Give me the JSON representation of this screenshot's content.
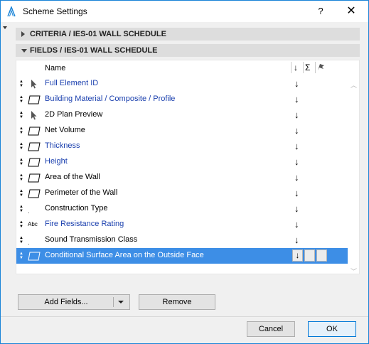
{
  "window": {
    "title": "Scheme Settings",
    "help_label": "?",
    "close_label": "✕"
  },
  "panels": {
    "criteria": {
      "label": "CRITERIA / IES-01 WALL SCHEDULE",
      "expanded": false
    },
    "fields": {
      "label": "FIELDS / IES-01 WALL SCHEDULE",
      "expanded": true
    }
  },
  "list": {
    "header": {
      "name": "Name",
      "sort": "↓",
      "sum": "Σ",
      "flag": "flag-icon"
    },
    "rows": [
      {
        "label": "Full Element ID",
        "icon": "pointer-icon",
        "blue": true,
        "sort": "↓"
      },
      {
        "label": "Building Material / Composite / Profile",
        "icon": "parallelogram-icon",
        "blue": true,
        "sort": "↓"
      },
      {
        "label": "2D Plan Preview",
        "icon": "pointer-icon",
        "blue": false,
        "sort": "↓"
      },
      {
        "label": "Net Volume",
        "icon": "parallelogram-icon",
        "blue": false,
        "sort": "↓"
      },
      {
        "label": "Thickness",
        "icon": "parallelogram-icon",
        "blue": true,
        "sort": "↓"
      },
      {
        "label": "Height",
        "icon": "parallelogram-icon",
        "blue": true,
        "sort": "↓"
      },
      {
        "label": "Area of the Wall",
        "icon": "parallelogram-icon",
        "blue": false,
        "sort": "↓"
      },
      {
        "label": "Perimeter of the Wall",
        "icon": "parallelogram-icon",
        "blue": false,
        "sort": "↓"
      },
      {
        "label": "Construction Type",
        "icon": "dot-icon",
        "blue": false,
        "sort": "↓"
      },
      {
        "label": "Fire Resistance Rating",
        "icon": "abc-icon",
        "icon_text": "Abc",
        "blue": true,
        "sort": "↓"
      },
      {
        "label": "Sound Transmission Class",
        "icon": "dot-icon",
        "blue": false,
        "sort": "↓"
      },
      {
        "label": "Conditional Surface Area on the Outside Face",
        "icon": "parallelogram-icon",
        "blue": false,
        "sort": "↓",
        "selected": true
      }
    ]
  },
  "buttons": {
    "add_fields": "Add Fields...",
    "remove": "Remove",
    "cancel": "Cancel",
    "ok": "OK"
  },
  "colors": {
    "selection": "#3d8ee6",
    "link_blue": "#1a3fae",
    "window_border": "#1883d7"
  }
}
